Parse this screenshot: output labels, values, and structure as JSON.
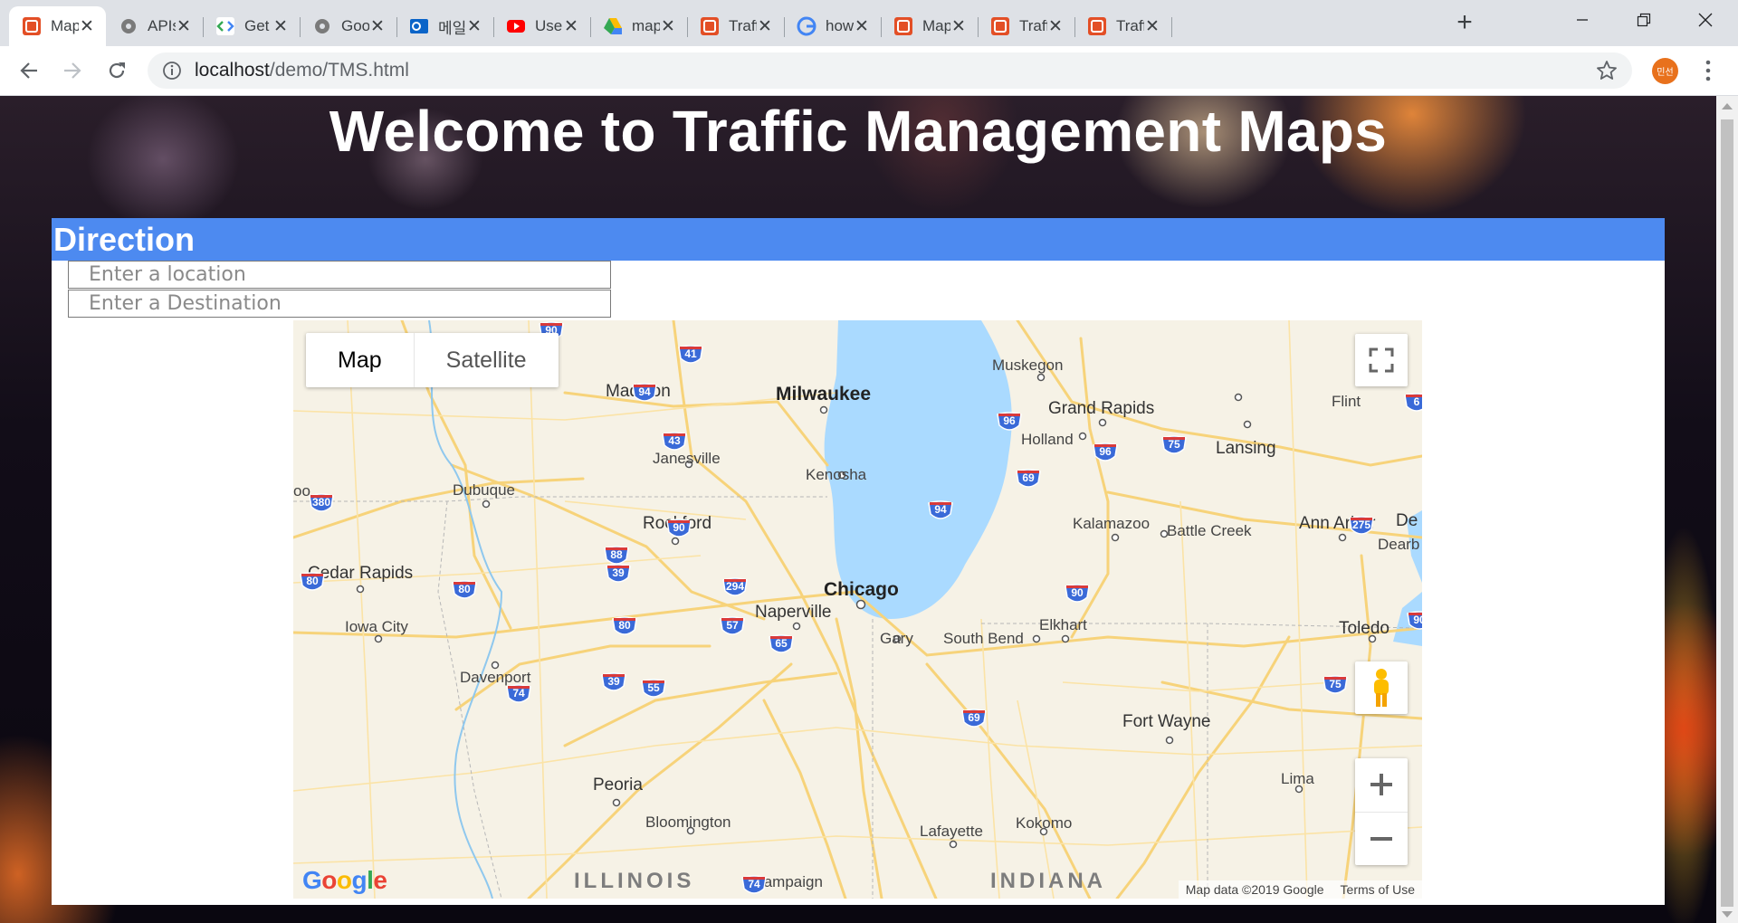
{
  "browser": {
    "tabs": [
      {
        "title": "Map",
        "icon": "html5-icon",
        "active": true
      },
      {
        "title": "APIs",
        "icon": "gear-icon"
      },
      {
        "title": "Get A",
        "icon": "code-icon"
      },
      {
        "title": "Goo",
        "icon": "gear-icon"
      },
      {
        "title": "메일",
        "icon": "outlook-icon"
      },
      {
        "title": "Use",
        "icon": "youtube-icon"
      },
      {
        "title": "map",
        "icon": "drive-icon"
      },
      {
        "title": "Traff",
        "icon": "html5-icon"
      },
      {
        "title": "how",
        "icon": "google-icon"
      },
      {
        "title": "Map",
        "icon": "html5-icon"
      },
      {
        "title": "Traff",
        "icon": "html5-icon"
      },
      {
        "title": "Traff",
        "icon": "html5-icon"
      }
    ],
    "new_tab_label": "+",
    "url_host": "localhost",
    "url_path": "/demo/TMS.html",
    "profile_initials": "민선",
    "accent_color": "#4d8af0"
  },
  "page": {
    "title": "Welcome to Traffic Management Maps",
    "panel_header": "Direction",
    "origin_placeholder": "Enter a location",
    "destination_placeholder": "Enter a Destination"
  },
  "map": {
    "type_buttons": {
      "map": "Map",
      "satellite": "Satellite"
    },
    "selected_type": "Map",
    "cities_large": [
      {
        "name": "Milwaukee"
      },
      {
        "name": "Chicago"
      }
    ],
    "cities": [
      {
        "name": "Madison"
      },
      {
        "name": "Muskegon"
      },
      {
        "name": "Grand Rapids"
      },
      {
        "name": "Holland"
      },
      {
        "name": "Flint"
      },
      {
        "name": "Lansing"
      },
      {
        "name": "Janesville"
      },
      {
        "name": "Kenosha"
      },
      {
        "name": "Dubuque"
      },
      {
        "name": "Rockford"
      },
      {
        "name": "Kalamazoo"
      },
      {
        "name": "Battle Creek"
      },
      {
        "name": "Ann Arbor"
      },
      {
        "name": "Cedar Rapids"
      },
      {
        "name": "Naperville"
      },
      {
        "name": "Iowa City"
      },
      {
        "name": "Gary"
      },
      {
        "name": "South Bend"
      },
      {
        "name": "Elkhart"
      },
      {
        "name": "Toledo"
      },
      {
        "name": "Davenport"
      },
      {
        "name": "Fort Wayne"
      },
      {
        "name": "Peoria"
      },
      {
        "name": "Lima"
      },
      {
        "name": "Bloomington"
      },
      {
        "name": "Lafayette"
      },
      {
        "name": "Kokomo"
      },
      {
        "name": "Champaign"
      },
      {
        "name": "Dearb"
      },
      {
        "name": "De"
      },
      {
        "name": "oo"
      }
    ],
    "states": [
      "ILLINOIS",
      "INDIANA"
    ],
    "shields": [
      "90",
      "41",
      "94",
      "43",
      "96",
      "75",
      "96",
      "69",
      "380",
      "94",
      "90",
      "275",
      "88",
      "39",
      "80",
      "80",
      "294",
      "90",
      "80",
      "57",
      "65",
      "39",
      "55",
      "74",
      "75",
      "69",
      "74",
      "6",
      "90"
    ],
    "attribution": {
      "data": "Map data ©2019 Google",
      "terms": "Terms of Use"
    },
    "logo": "Google"
  }
}
